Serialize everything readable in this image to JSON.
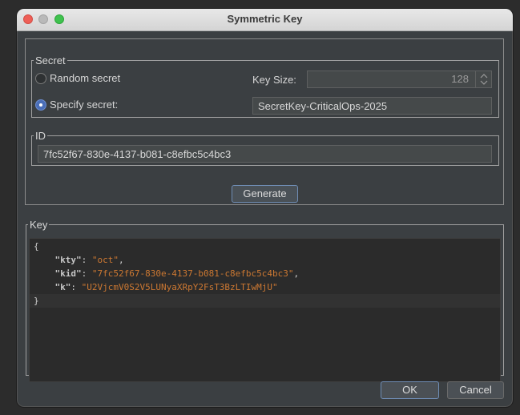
{
  "window": {
    "title": "Symmetric Key"
  },
  "secret": {
    "legend": "Secret",
    "random_label": "Random secret",
    "random_checked": false,
    "specify_label": "Specify secret:",
    "specify_checked": true,
    "key_size_label": "Key Size:",
    "key_size_value": "128",
    "secret_value": "SecretKey-CriticalOps-2025"
  },
  "id": {
    "legend": "ID",
    "value": "7fc52f67-830e-4137-b081-c8efbc5c4bc3"
  },
  "generate_label": "Generate",
  "key": {
    "legend": "Key",
    "open_brace": "{",
    "close_brace": "}",
    "entries": [
      {
        "key": "\"kty\"",
        "colon": ": ",
        "value": "\"oct\"",
        "comma": ","
      },
      {
        "key": "\"kid\"",
        "colon": ": ",
        "value": "\"7fc52f67-830e-4137-b081-c8efbc5c4bc3\"",
        "comma": ","
      },
      {
        "key": "\"k\"",
        "colon": ": ",
        "value": "\"U2VjcmV0S2V5LUNyaXRpY2FsT3BzLTIwMjU\"",
        "comma": ""
      }
    ]
  },
  "footer": {
    "ok_label": "OK",
    "cancel_label": "Cancel"
  },
  "colors": {
    "accent": "#4a6eb8",
    "json_string": "#cc7832"
  }
}
